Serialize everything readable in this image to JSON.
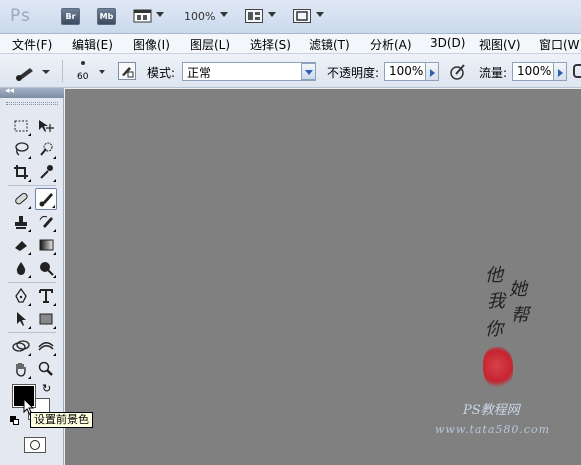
{
  "titlebar": {
    "logo": "Ps",
    "bridge_label": "Br",
    "minibridge_label": "Mb",
    "zoom": "100%"
  },
  "menu": {
    "items": [
      "文件(F)",
      "编辑(E)",
      "图像(I)",
      "图层(L)",
      "选择(S)",
      "滤镜(T)",
      "分析(A)",
      "3D(D)",
      "视图(V)",
      "窗口(W)"
    ]
  },
  "options": {
    "brush_size": "60",
    "mode_label": "模式:",
    "mode_value": "正常",
    "opacity_label": "不透明度:",
    "opacity_value": "100%",
    "flow_label": "流量:",
    "flow_value": "100%"
  },
  "tools": {
    "collapse_label": "◂◂",
    "tooltip": "设置前景色",
    "foreground_color": "#000000",
    "background_color": "#ffffff"
  },
  "watermark": {
    "line1": "他",
    "line2": "她",
    "line3": "我",
    "line4": "帮",
    "line5": "你",
    "site_name": "PS教程网",
    "url": "www.tata580.com"
  },
  "colors": {
    "canvas": "#808080",
    "accent": "#2a5fb4"
  }
}
